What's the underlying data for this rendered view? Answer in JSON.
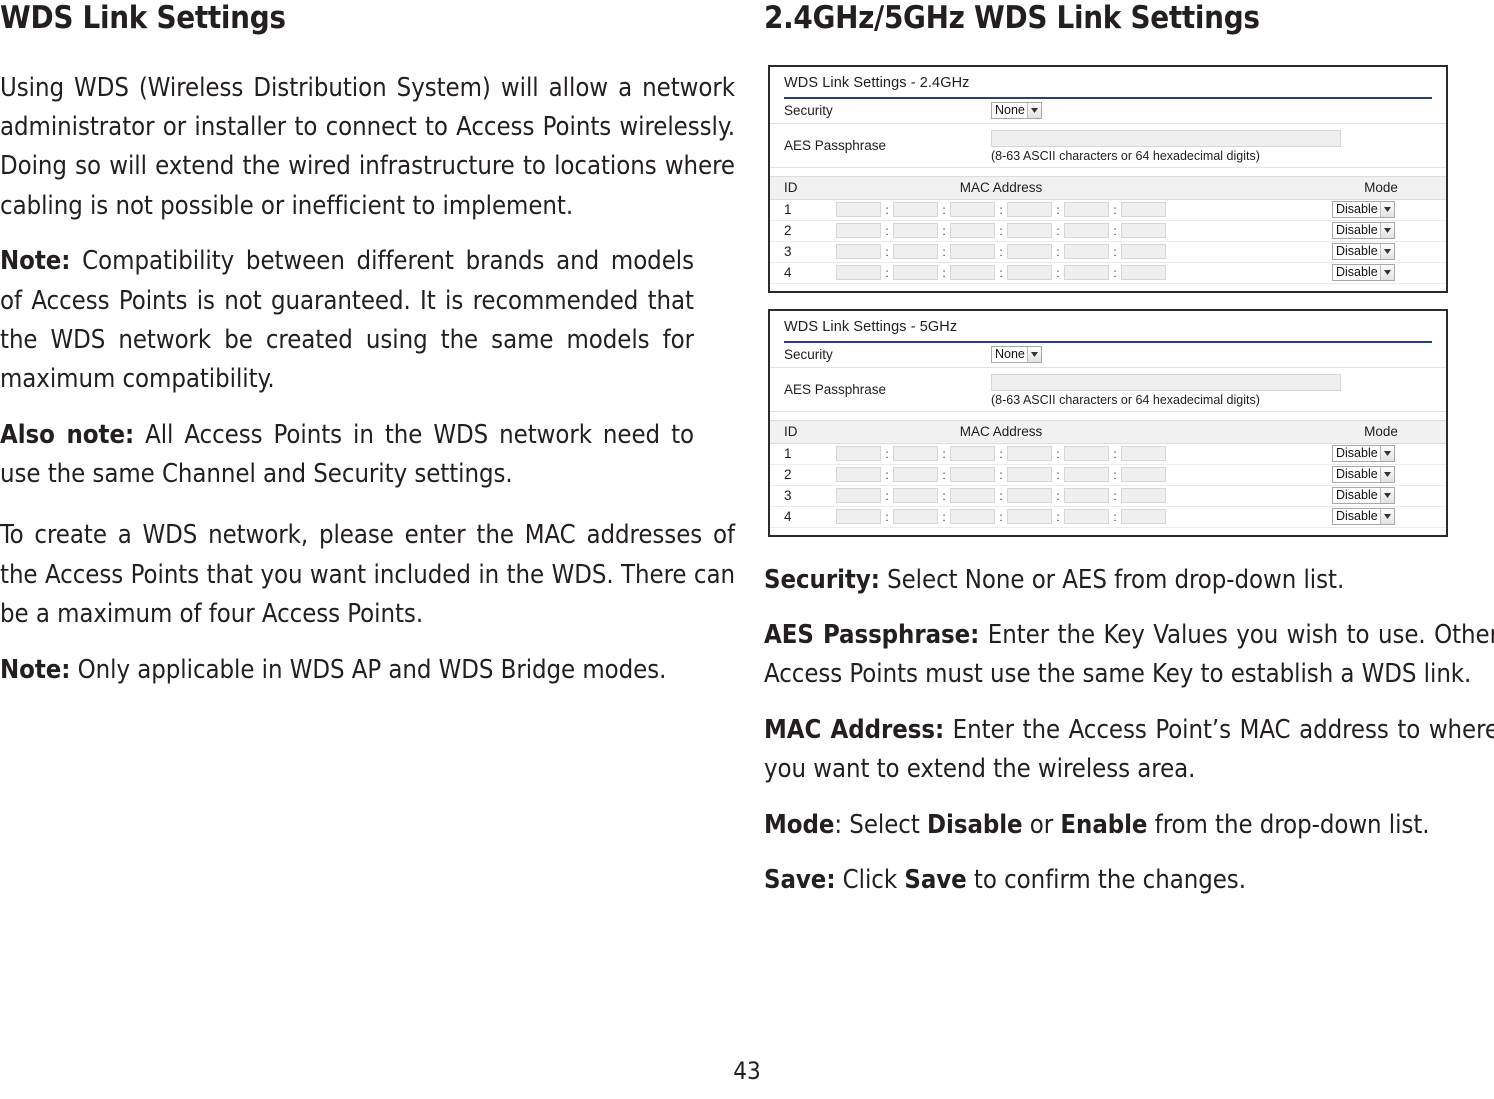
{
  "page": {
    "number": "43"
  },
  "left_column": {
    "title": "WDS Link Settings",
    "paragraph_1": "Using WDS (Wireless Distribution System) will allow a network administrator or installer to connect to Access Points wirelessly. Doing so will extend the wired infrastructure to locations where cabling is not possible or inefficient to implement.",
    "note_1_label": "Note:",
    "note_1_text": " Compatibility between different brands and models of Access Points is not guaranteed. It is recommended that the WDS network be created using the same models for maximum compatibility.",
    "also_note_label": "Also note:",
    "also_note_text": " All Access Points in the WDS network need to use the same Channel and Security settings.",
    "paragraph_2": "To create a WDS network, please enter the MAC addresses of the Access Points that you want included in the WDS. There can be a maximum of four Access Points.",
    "note_2_label": "Note:",
    "note_2_text": " Only applicable in WDS AP and WDS Bridge modes."
  },
  "right_column": {
    "title": "2.4GHz/5GHz WDS Link Settings",
    "descriptions": {
      "security_label": "Security:",
      "security_text": " Select None or AES from drop-down list.",
      "aes_label": "AES Passphrase:",
      "aes_text": " Enter the Key Values you wish to use. Other Access Points must use the same Key to establish a WDS link.",
      "mac_label": "MAC Address:",
      "mac_text": " Enter the Access Point’s MAC address to where you want to extend the wireless area.",
      "mode_label": "Mode",
      "mode_text_1": ": Select ",
      "mode_value_1": "Disable",
      "mode_text_2": " or ",
      "mode_value_2": "Enable",
      "mode_text_3": " from the drop-down list.",
      "save_label": "Save:",
      "save_text_1": " Click ",
      "save_value": "Save",
      "save_text_2": " to confirm the changes."
    }
  },
  "figures": {
    "panel_24ghz": {
      "title": "WDS Link Settings - 2.4GHz",
      "security_label": "Security",
      "security_value": "None",
      "aes_label": "AES Passphrase",
      "aes_value": "",
      "aes_hint": "(8-63 ASCII characters or 64 hexadecimal digits)",
      "columns": {
        "id": "ID",
        "mac_address": "MAC Address",
        "mode": "Mode"
      },
      "rows": [
        {
          "id": "1",
          "mac": [
            "",
            "",
            "",
            "",
            "",
            ""
          ],
          "mode": "Disable"
        },
        {
          "id": "2",
          "mac": [
            "",
            "",
            "",
            "",
            "",
            ""
          ],
          "mode": "Disable"
        },
        {
          "id": "3",
          "mac": [
            "",
            "",
            "",
            "",
            "",
            ""
          ],
          "mode": "Disable"
        },
        {
          "id": "4",
          "mac": [
            "",
            "",
            "",
            "",
            "",
            ""
          ],
          "mode": "Disable"
        }
      ]
    },
    "panel_5ghz": {
      "title": "WDS Link Settings - 5GHz",
      "security_label": "Security",
      "security_value": "None",
      "aes_label": "AES Passphrase",
      "aes_value": "",
      "aes_hint": "(8-63 ASCII characters or 64 hexadecimal digits)",
      "columns": {
        "id": "ID",
        "mac_address": "MAC Address",
        "mode": "Mode"
      },
      "rows": [
        {
          "id": "1",
          "mac": [
            "",
            "",
            "",
            "",
            "",
            ""
          ],
          "mode": "Disable"
        },
        {
          "id": "2",
          "mac": [
            "",
            "",
            "",
            "",
            "",
            ""
          ],
          "mode": "Disable"
        },
        {
          "id": "3",
          "mac": [
            "",
            "",
            "",
            "",
            "",
            ""
          ],
          "mode": "Disable"
        },
        {
          "id": "4",
          "mac": [
            "",
            "",
            "",
            "",
            "",
            ""
          ],
          "mode": "Disable"
        }
      ]
    }
  },
  "colors": {
    "divider_navy": "#2a3f77",
    "panel_border": "#2b2b2b",
    "header_band": "#f1f1f1",
    "text": "#231f20"
  }
}
